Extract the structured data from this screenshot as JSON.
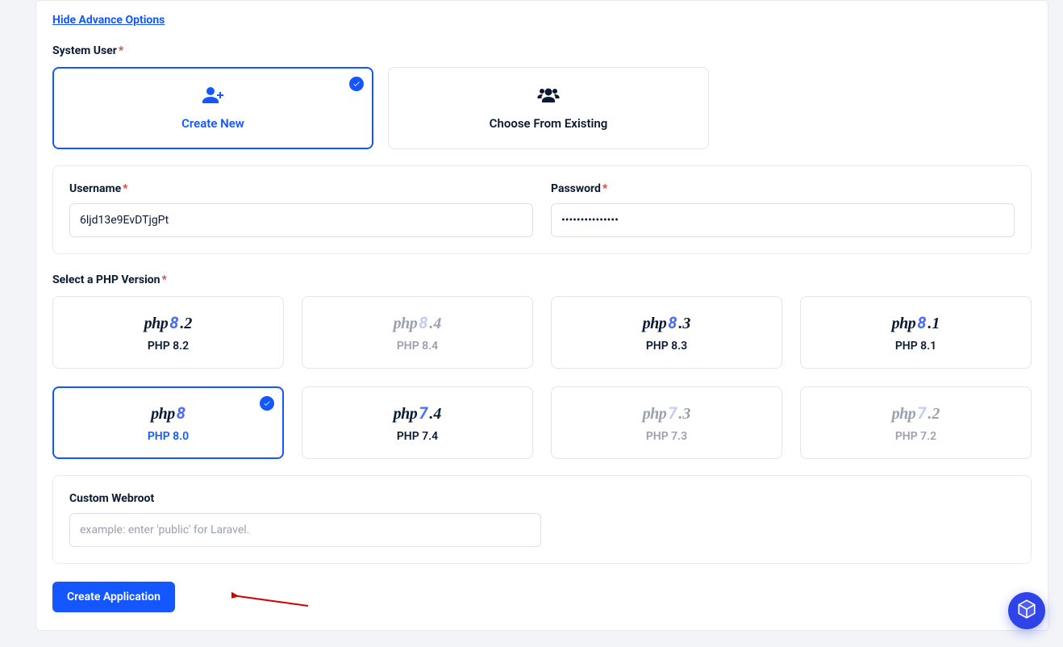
{
  "advance_link": "Hide Advance Options",
  "system_user": {
    "label": "System User",
    "options": [
      {
        "label": "Create New",
        "selected": true
      },
      {
        "label": "Choose From Existing",
        "selected": false
      }
    ]
  },
  "username": {
    "label": "Username",
    "value": "6ljd13e9EvDTjgPt"
  },
  "password": {
    "label": "Password",
    "value": "•••••••••••••••"
  },
  "php_section_label": "Select a PHP Version",
  "php_versions": [
    {
      "major": "8",
      "minor": ".2",
      "label": "PHP 8.2",
      "selected": false,
      "disabled": false
    },
    {
      "major": "8",
      "minor": ".4",
      "label": "PHP 8.4",
      "selected": false,
      "disabled": true
    },
    {
      "major": "8",
      "minor": ".3",
      "label": "PHP 8.3",
      "selected": false,
      "disabled": false
    },
    {
      "major": "8",
      "minor": ".1",
      "label": "PHP 8.1",
      "selected": false,
      "disabled": false
    },
    {
      "major": "8",
      "minor": "",
      "label": "PHP 8.0",
      "selected": true,
      "disabled": false
    },
    {
      "major": "7",
      "minor": ".4",
      "label": "PHP 7.4",
      "selected": false,
      "disabled": false
    },
    {
      "major": "7",
      "minor": ".3",
      "label": "PHP 7.3",
      "selected": false,
      "disabled": true
    },
    {
      "major": "7",
      "minor": ".2",
      "label": "PHP 7.2",
      "selected": false,
      "disabled": true
    }
  ],
  "webroot": {
    "label": "Custom Webroot",
    "placeholder": "example: enter 'public' for Laravel.",
    "value": ""
  },
  "submit_label": "Create Application"
}
